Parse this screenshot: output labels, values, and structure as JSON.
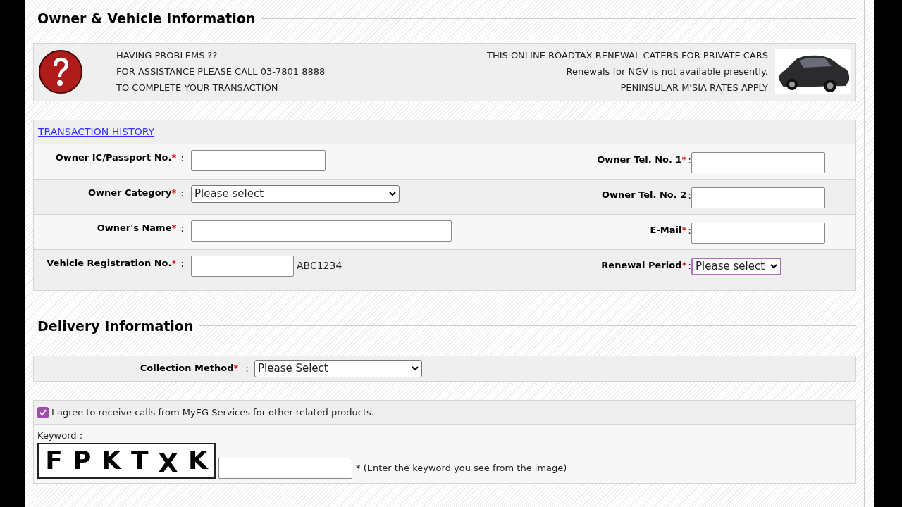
{
  "owner_section": {
    "title": "Owner & Vehicle Information",
    "help_lines": [
      "HAVING PROBLEMS ??",
      "FOR ASSISTANCE PLEASE CALL 03-7801 8888",
      "TO COMPLETE YOUR TRANSACTION"
    ],
    "notice_lines": [
      "THIS ONLINE ROADTAX RENEWAL CATERS FOR PRIVATE CARS",
      "Renewals for NGV is not available presently.",
      "PENINSULAR M'SIA RATES APPLY"
    ],
    "history_link": "TRANSACTION HISTORY",
    "rows": [
      {
        "left": {
          "label": "Owner IC/Passport No.",
          "required_mark": "*",
          "colon": ":",
          "kind": "input"
        },
        "right": {
          "label": "Owner Tel. No. 1",
          "required_mark": "*",
          "colon": ":",
          "kind": "input"
        }
      },
      {
        "left": {
          "label": "Owner Category",
          "required_mark": "*",
          "colon": ":",
          "kind": "select",
          "value": "Please select"
        },
        "right": {
          "label": "Owner Tel. No. 2",
          "colon": ":",
          "kind": "input"
        }
      },
      {
        "left": {
          "label": "Owner's Name",
          "required_mark": "*",
          "colon": ":",
          "kind": "input"
        },
        "right": {
          "label": "E-Mail",
          "required_mark": "*",
          "colon": ":",
          "kind": "input"
        }
      },
      {
        "left": {
          "label": "Vehicle Registration No.",
          "required_mark": "*",
          "colon": ":",
          "kind": "input",
          "hint": "ABC1234"
        },
        "right": {
          "label": "Renewal Period",
          "required_mark": "*",
          "colon": ":",
          "kind": "select",
          "value": "Please select",
          "focused": true
        }
      }
    ]
  },
  "delivery_section": {
    "title": "Delivery Information",
    "collection": {
      "label": "Collection Method",
      "required_mark": "*",
      "colon": ":",
      "value": "Please Select"
    }
  },
  "consent": {
    "label": "I agree to receive calls from MyEG Services for other related products.",
    "checked": true
  },
  "keyword": {
    "label": "Keyword :",
    "captcha": [
      "F",
      "P",
      "K",
      "T",
      "X",
      "K"
    ],
    "note": "* (Enter the keyword you see from the image)"
  }
}
